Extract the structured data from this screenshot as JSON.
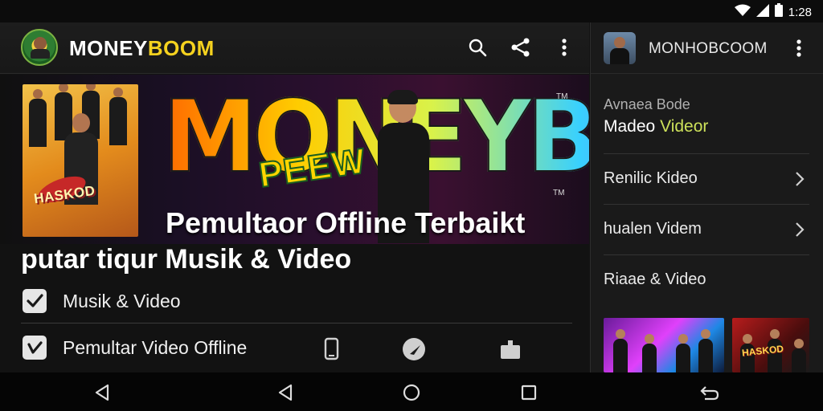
{
  "status_bar": {
    "time": "1:28"
  },
  "app_bar": {
    "title_part1": "MONEY",
    "title_part2": "BOOM"
  },
  "banner": {
    "poster_text": "HASKOD",
    "logo_text": "MONEYBOOM",
    "overlay_text": "PEEW",
    "trademark": "TM"
  },
  "headline": {
    "line1": "Pemultaor Offline Terbaikt",
    "line2": "putar tiqur Musik & Video"
  },
  "features": [
    {
      "label": "Musik & Video"
    },
    {
      "label": "Pemultar Video Offline"
    }
  ],
  "right_panel": {
    "title": "MONHOBCOOM",
    "subtitle": "Avnaea Bode",
    "heading_part1": "Madeo",
    "heading_part2": "Videor",
    "items": [
      {
        "label": "Renilic Kideo"
      },
      {
        "label": "hualen Videm"
      },
      {
        "label": "Riaae & Video"
      }
    ],
    "thumb_text": "HASKOD"
  },
  "colors": {
    "accent": "#f5d21f",
    "accent_green": "#cde15a",
    "background": "#121212"
  }
}
